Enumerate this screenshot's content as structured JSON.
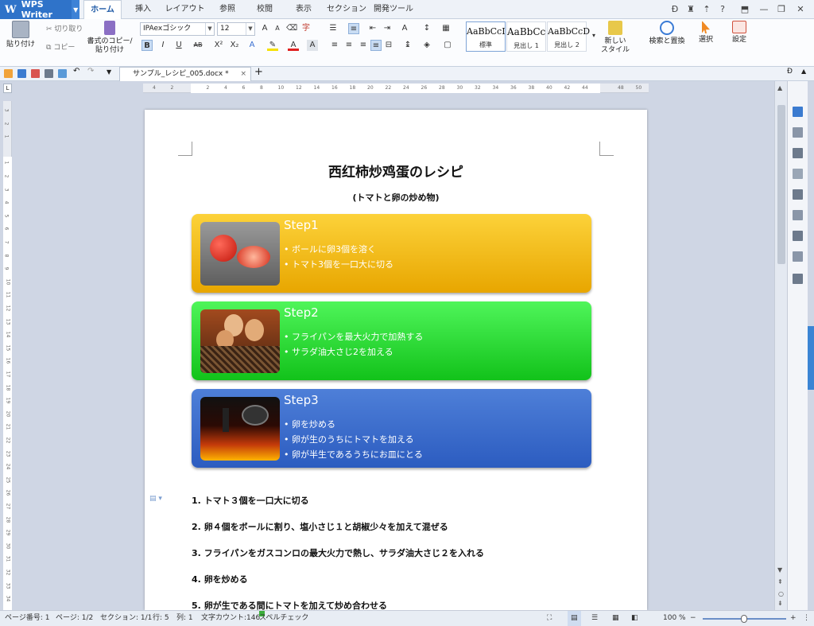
{
  "app": {
    "name": "WPS Writer",
    "logo_letter": "W"
  },
  "tabs": [
    "ホーム",
    "挿入",
    "レイアウト",
    "参照",
    "校閲",
    "表示",
    "セクション",
    "開発ツール"
  ],
  "ribbon": {
    "paste": "貼り付け",
    "cut": "切り取り",
    "copy": "コピー",
    "format_painter_line1": "書式のコピー/",
    "format_painter_line2": "貼り付け",
    "font_name": "IPAexゴシック",
    "font_size": "12",
    "styles": [
      {
        "preview": "AaBbCcI",
        "name": "標準"
      },
      {
        "preview": "AaBbCc",
        "name": "見出し 1"
      },
      {
        "preview": "AaBbCcD",
        "name": "見出し 2"
      }
    ],
    "new_style_line1": "新しい",
    "new_style_line2": "スタイル",
    "find_replace": "検索と置換",
    "select": "選択",
    "settings": "設定"
  },
  "document_tab": {
    "filename": "サンプル_レシピ_005.docx *"
  },
  "ruler_ticks": [
    "4",
    "2",
    "",
    "2",
    "4",
    "6",
    "8",
    "10",
    "12",
    "14",
    "16",
    "18",
    "20",
    "22",
    "24",
    "26",
    "28",
    "30",
    "32",
    "34",
    "36",
    "38",
    "40",
    "42",
    "44",
    "",
    "48",
    "50"
  ],
  "vruler_ticks": [
    "3",
    "2",
    "1",
    "",
    "1",
    "2",
    "3",
    "4",
    "5",
    "6",
    "7",
    "8",
    "9",
    "10",
    "11",
    "12",
    "13",
    "14",
    "15",
    "16",
    "17",
    "18",
    "19",
    "20",
    "21",
    "22",
    "23",
    "24",
    "25",
    "26",
    "27",
    "28",
    "29",
    "30",
    "31",
    "32",
    "33",
    "34"
  ],
  "document": {
    "title": "西红柿炒鸡蛋のレシピ",
    "subtitle": "(トマトと卵の炒め物)",
    "steps": [
      {
        "title": "Step1",
        "bullets": [
          "ボールに卵3個を溶く",
          "トマト3個を一口大に切る"
        ],
        "color_top": "#fcd23a",
        "color_bottom": "#e8a600"
      },
      {
        "title": "Step2",
        "bullets": [
          "フライパンを最大火力で加熱する",
          "サラダ油大さじ2を加える"
        ],
        "color_top": "#4ff55a",
        "color_bottom": "#12c21a"
      },
      {
        "title": "Step3",
        "bullets": [
          "卵を炒める",
          "卵が生のうちにトマトを加える",
          "卵が半生であるうちにお皿にとる"
        ],
        "color_top": "#4e7fd8",
        "color_bottom": "#2c5cc0"
      }
    ],
    "instructions": [
      {
        "num": "1.",
        "text": "トマト３個を一口大に切る"
      },
      {
        "num": "2.",
        "text": "卵４個をボールに割り、塩小さじ１と胡椒少々を加えて混ぜる"
      },
      {
        "num": "3.",
        "text": "フライパンをガスコンロの最大火力で熱し、サラダ油大さじ２を入れる"
      },
      {
        "num": "4.",
        "text": "卵を炒める"
      },
      {
        "num": "5.",
        "text": "卵が生である間にトマトを加えて炒め合わせる"
      }
    ]
  },
  "status": {
    "page_number": "ページ番号: 1",
    "pages": "ページ: 1/2",
    "section": "セクション: 1/1",
    "row": "行: 5",
    "col": "列: 1",
    "word_count": "文字カウント:146",
    "spellcheck": "スペルチェック",
    "zoom": "100 %"
  },
  "colors": {
    "accent": "#2f73c9",
    "ribbon_bg": "#fbfcfe"
  }
}
